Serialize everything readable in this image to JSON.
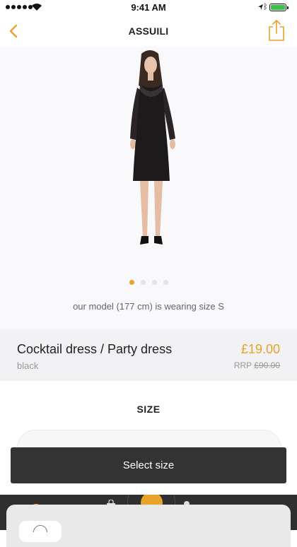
{
  "status_bar": {
    "time": "9:41 AM"
  },
  "nav": {
    "title": "ASSUILI"
  },
  "gallery": {
    "page_count": 4,
    "active_index": 0,
    "caption": "our model (177 cm) is wearing size S"
  },
  "product": {
    "name": "Cocktail dress / Party dress",
    "color": "black",
    "price": "£19.00",
    "rrp_label": "RRP",
    "rrp_value": "£90.00"
  },
  "size": {
    "heading": "SIZE",
    "button_label": "Select size"
  },
  "colors": {
    "accent": "#e8a32a",
    "button_bg": "#333333",
    "tab_bar_bg": "#2f2f2f"
  },
  "icons": {
    "back": "chevron-left-icon",
    "share": "share-icon",
    "tabs": [
      "sun-icon",
      "shopping-bag-icon",
      "center-action-icon",
      "user-icon"
    ]
  }
}
